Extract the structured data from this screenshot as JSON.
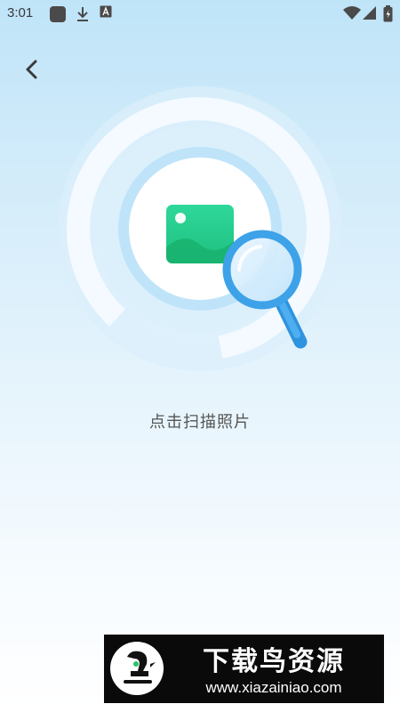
{
  "status_bar": {
    "time": "3:01",
    "icons": [
      "app-square-icon",
      "download-icon",
      "text-a-icon",
      "wifi-icon",
      "signal-icon",
      "battery-icon"
    ]
  },
  "nav": {
    "back_icon": "chevron-left-icon"
  },
  "main": {
    "illustration_icons": [
      "photo-icon",
      "magnifier-icon"
    ],
    "scan_prompt": "点击扫描照片"
  },
  "watermark": {
    "brand": "下载鸟资源",
    "url": "www.xiazainiao.com"
  },
  "colors": {
    "photo_green": "#27c98b",
    "magnifier_blue": "#3da2e8",
    "background_top": "#bfe4f8",
    "text_gray": "#555555"
  }
}
